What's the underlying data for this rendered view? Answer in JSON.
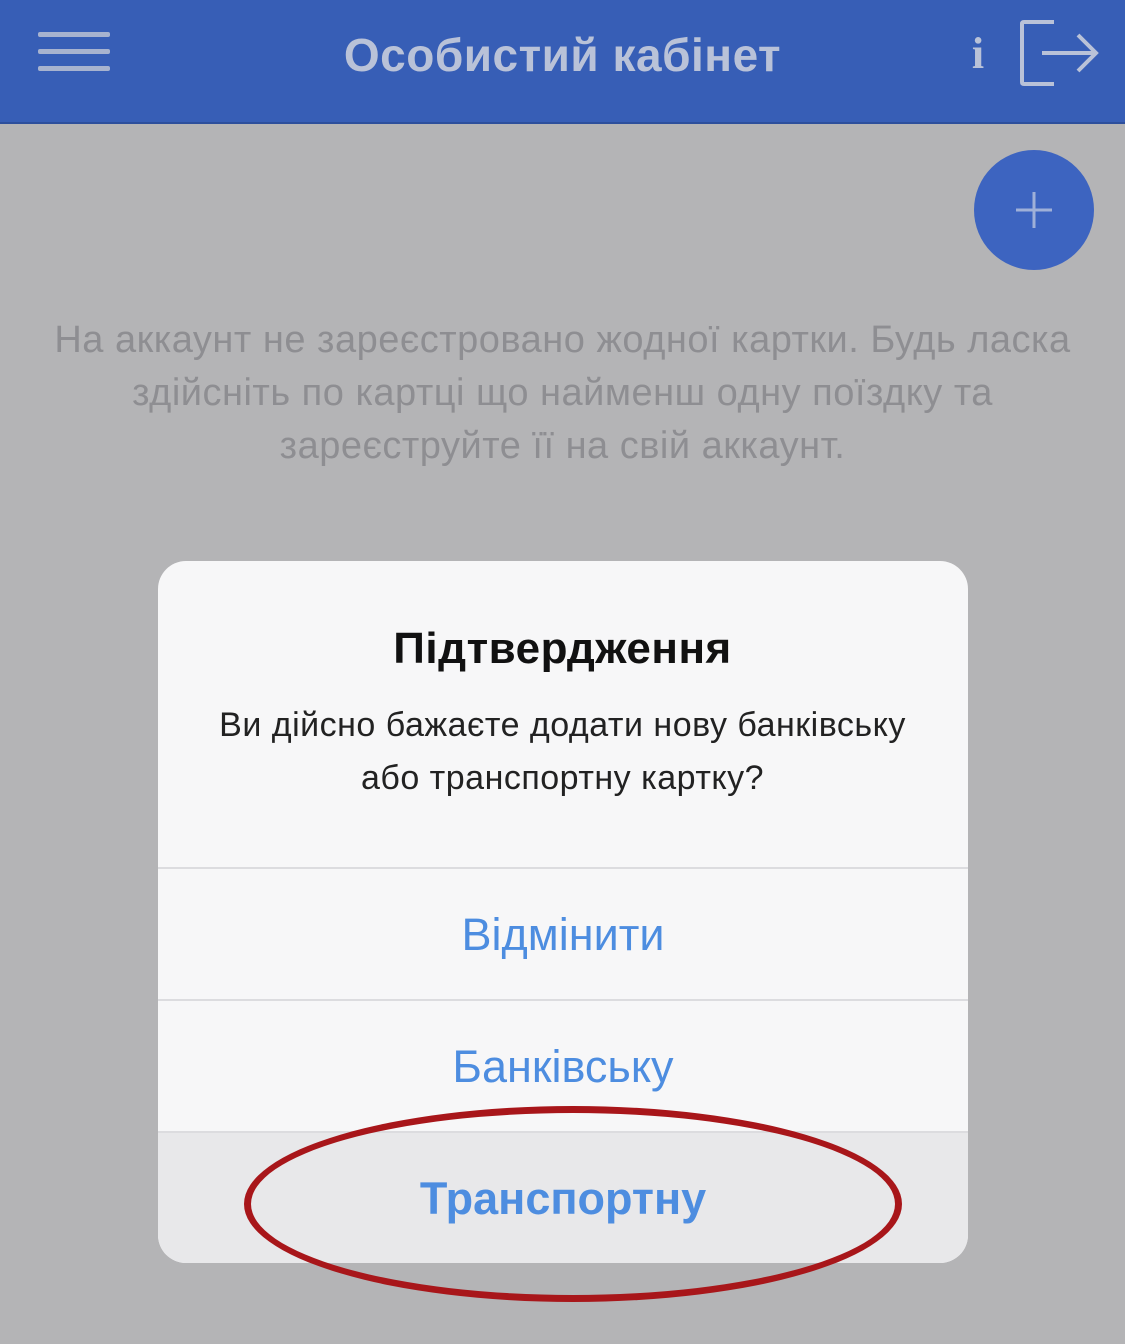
{
  "header": {
    "title": "Особистий кабінет",
    "info_label": "i",
    "menu_icon": "hamburger-menu-icon",
    "logout_icon": "logout-icon"
  },
  "fab": {
    "icon": "plus-icon"
  },
  "empty_message": "На аккаунт не зареєстровано жодної картки. Будь ласка здійсніть по картці що найменш одну поїздку та зареєструйте її на свій аккаунт.",
  "dialog": {
    "title": "Підтвердження",
    "message": "Ви дійсно бажаєте додати нову банківську або транспортну картку?",
    "buttons": {
      "cancel": "Відмінити",
      "bank": "Банківську",
      "transport": "Транспортну"
    }
  },
  "colors": {
    "header_bg": "#375eb6",
    "accent_blue": "#4d8de0",
    "highlight_red": "#a8161a",
    "overlay": "#b4b4b6"
  }
}
